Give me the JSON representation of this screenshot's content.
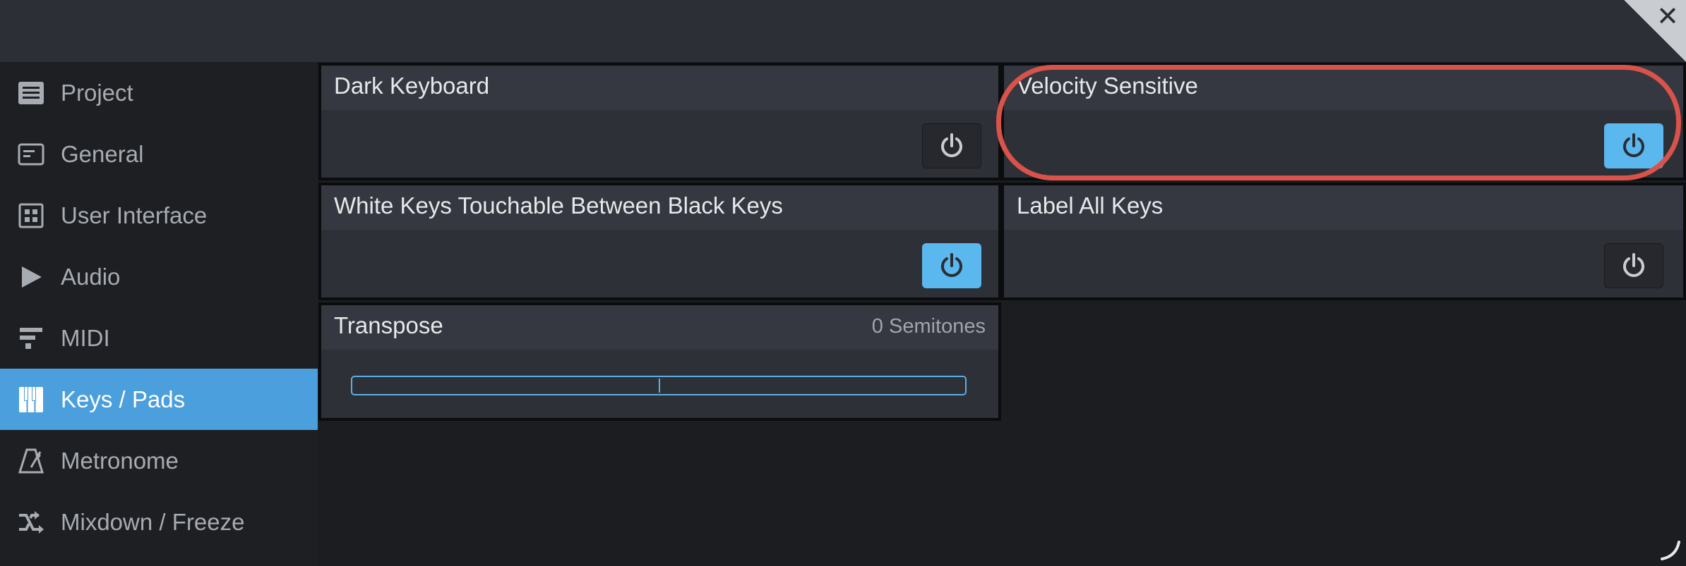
{
  "sidebar": {
    "items": [
      {
        "label": "Project",
        "icon": "list-icon",
        "active": false
      },
      {
        "label": "General",
        "icon": "window-icon",
        "active": false
      },
      {
        "label": "User Interface",
        "icon": "grid-icon",
        "active": false
      },
      {
        "label": "Audio",
        "icon": "play-icon",
        "active": false
      },
      {
        "label": "MIDI",
        "icon": "midi-bars-icon",
        "active": false
      },
      {
        "label": "Keys / Pads",
        "icon": "piano-keys-icon",
        "active": true
      },
      {
        "label": "Metronome",
        "icon": "metronome-icon",
        "active": false
      },
      {
        "label": "Mixdown / Freeze",
        "icon": "route-icon",
        "active": false
      }
    ]
  },
  "settings": {
    "dark_keyboard": {
      "label": "Dark Keyboard",
      "enabled": false
    },
    "velocity_sensitive": {
      "label": "Velocity Sensitive",
      "enabled": true
    },
    "white_keys_touchable": {
      "label": "White Keys Touchable Between Black Keys",
      "enabled": true
    },
    "label_all_keys": {
      "label": "Label All Keys",
      "enabled": false
    },
    "transpose": {
      "label": "Transpose",
      "value_text": "0 Semitones",
      "value": 0
    }
  },
  "colors": {
    "accent": "#4a9fdc",
    "toggle_on": "#5ab8ee",
    "highlight": "#d9534a"
  }
}
